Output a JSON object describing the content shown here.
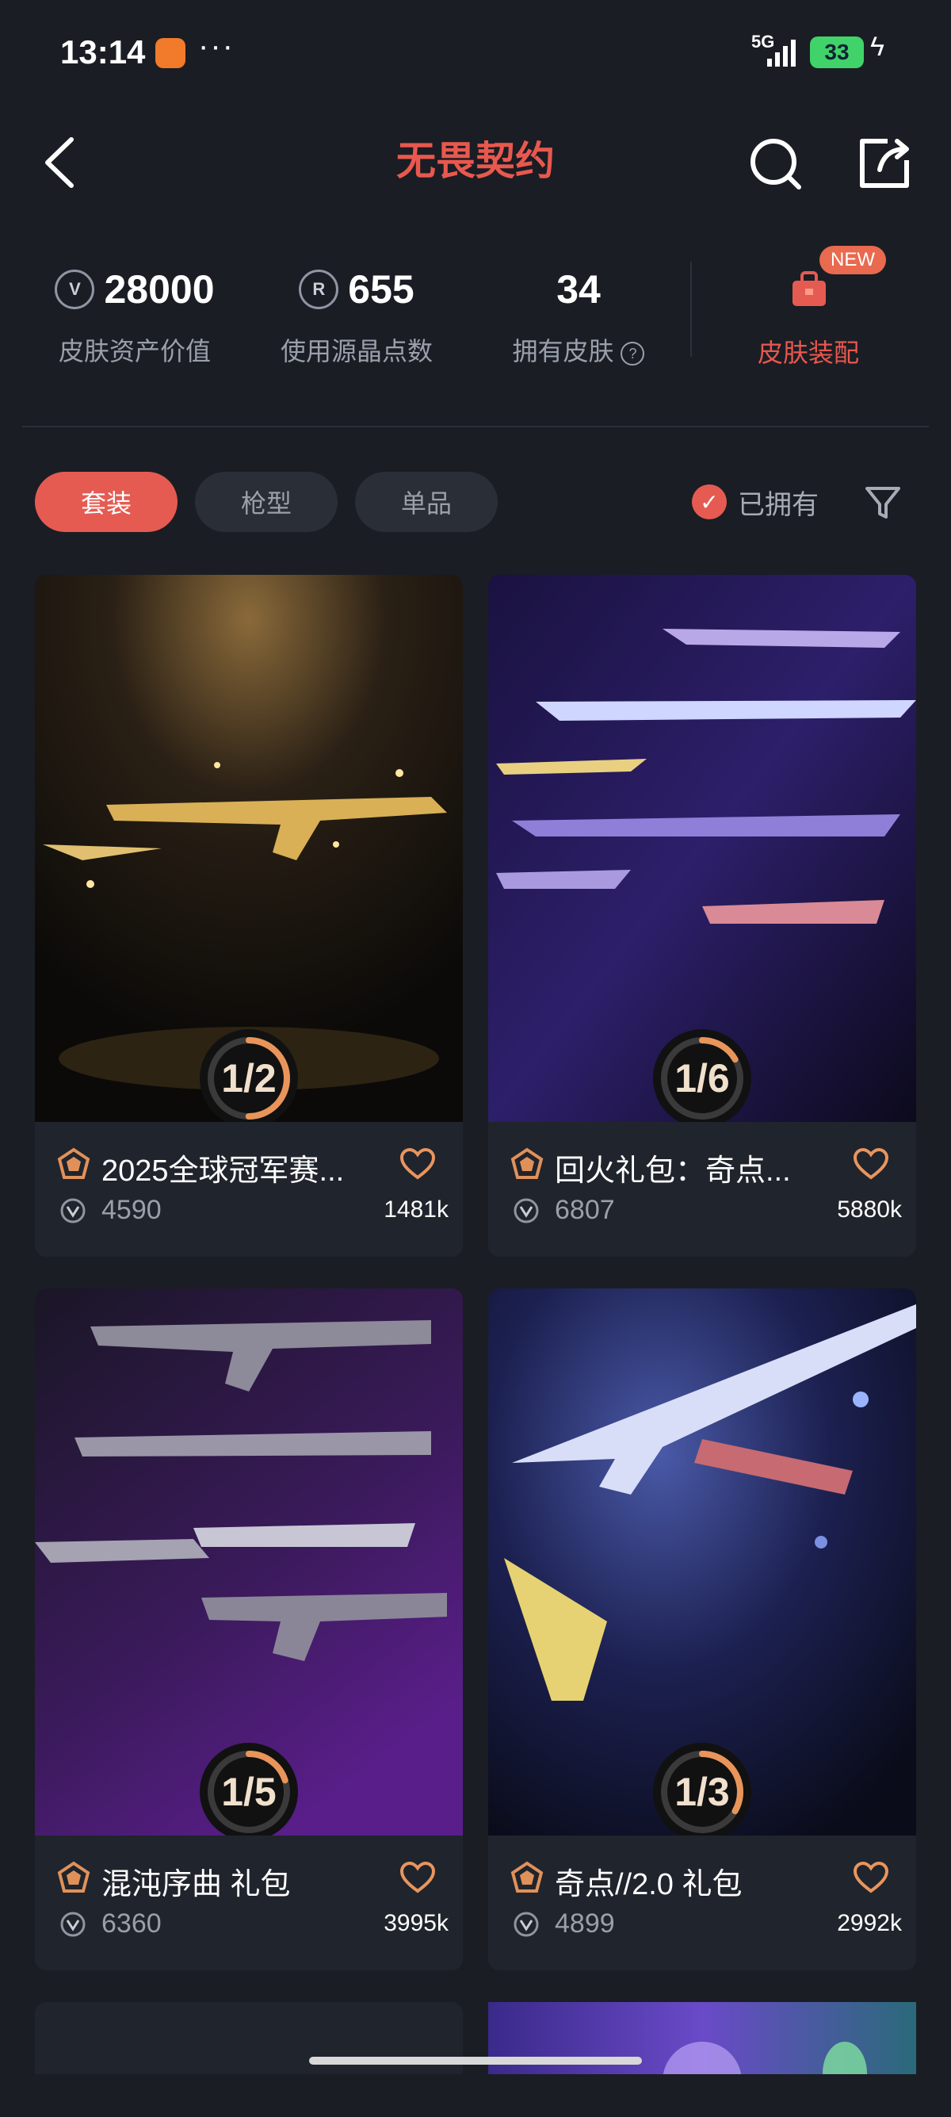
{
  "status": {
    "time": "13:14",
    "more": "···",
    "network": "5G",
    "battery": "33"
  },
  "header": {
    "title": "无畏契约"
  },
  "stats": [
    {
      "value": "28000",
      "label": "皮肤资产价值",
      "icon": "vp-coin-icon"
    },
    {
      "value": "655",
      "label": "使用源晶点数",
      "icon": "radianite-icon"
    },
    {
      "value": "34",
      "label": "拥有皮肤",
      "icon": "help-circle-icon"
    }
  ],
  "equip": {
    "badge": "NEW",
    "label": "皮肤装配"
  },
  "tabs": [
    {
      "label": "套装",
      "active": true
    },
    {
      "label": "枪型",
      "active": false
    },
    {
      "label": "单品",
      "active": false
    }
  ],
  "filter": {
    "owned_label": "已拥有"
  },
  "cards": [
    {
      "progress": "1/2",
      "progress_frac": 0.5,
      "name": "2025全球冠军赛...",
      "price": "4590",
      "likes": "1481k"
    },
    {
      "progress": "1/6",
      "progress_frac": 0.1667,
      "name": "回火礼包：奇点...",
      "price": "6807",
      "likes": "5880k"
    },
    {
      "progress": "1/5",
      "progress_frac": 0.2,
      "name": "混沌序曲 礼包",
      "price": "6360",
      "likes": "3995k"
    },
    {
      "progress": "1/3",
      "progress_frac": 0.3333,
      "name": "奇点//2.0 礼包",
      "price": "4899",
      "likes": "2992k"
    }
  ],
  "colors": {
    "accent": "#e55b52",
    "bg": "#1a1d24",
    "card": "#20242c",
    "progress": "#e9955a"
  }
}
